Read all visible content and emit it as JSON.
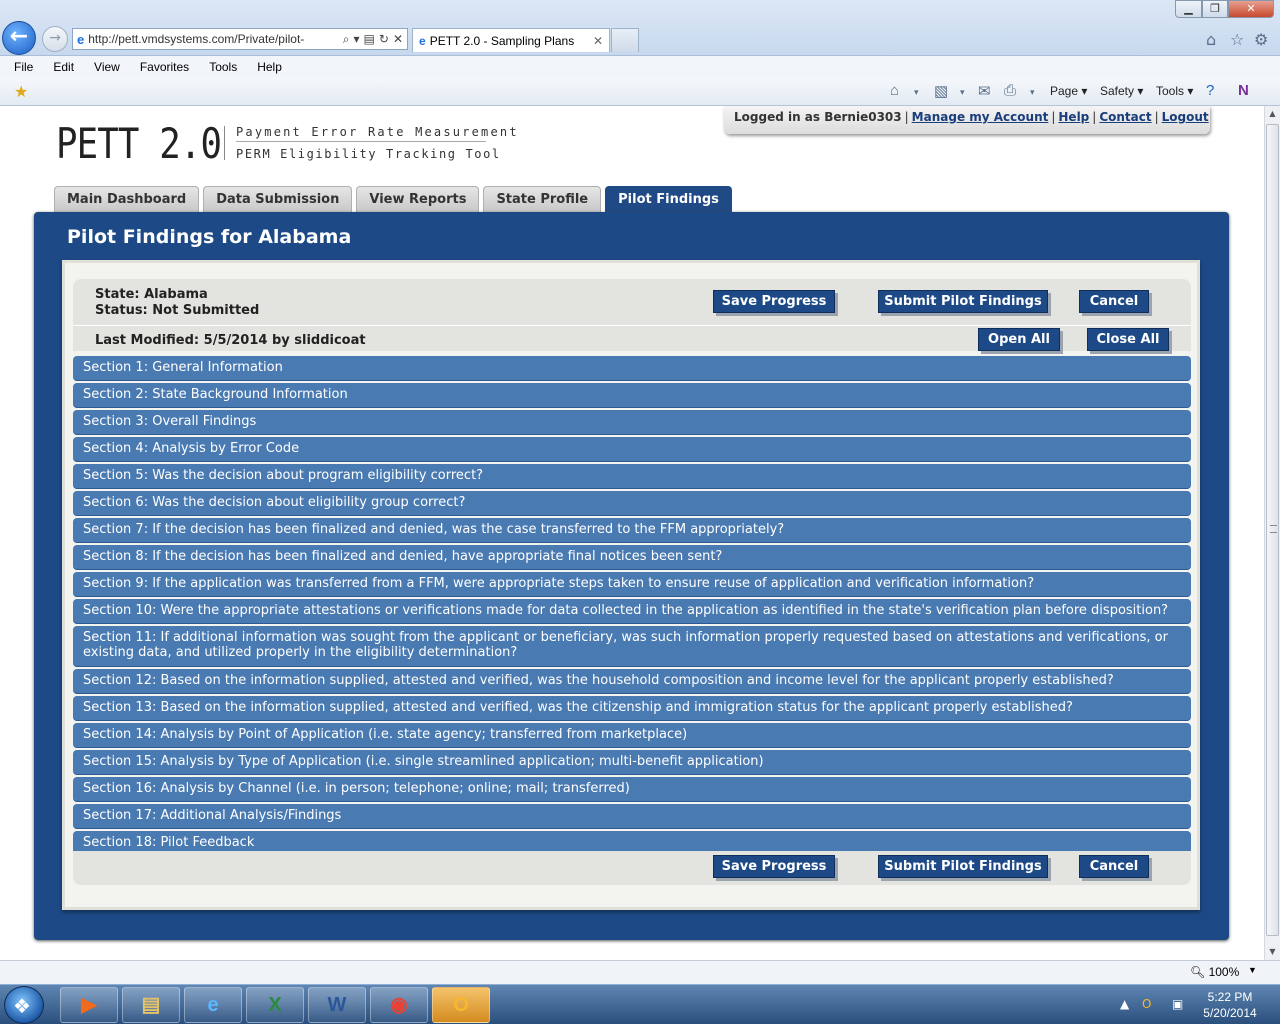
{
  "browser": {
    "url": "http://pett.vmdsystems.com/Private/pilot-",
    "tab_title": "PETT 2.0 - Sampling Plans",
    "menu": [
      "File",
      "Edit",
      "View",
      "Favorites",
      "Tools",
      "Help"
    ],
    "command_bar": {
      "page": "Page ▾",
      "safety": "Safety ▾",
      "tools": "Tools ▾"
    },
    "zoom": "100%"
  },
  "logo": {
    "main": "PETT 2.0",
    "line1": "Payment Error Rate Measurement",
    "line2": "PERM Eligibility Tracking Tool"
  },
  "account": {
    "logged_in": "Logged in as Bernie0303",
    "manage": "Manage my Account",
    "help": "Help",
    "contact": "Contact",
    "logout": "Logout"
  },
  "tabs": [
    {
      "label": "Main Dashboard"
    },
    {
      "label": "Data Submission"
    },
    {
      "label": "View Reports"
    },
    {
      "label": "State Profile"
    },
    {
      "label": "Pilot Findings"
    }
  ],
  "panel": {
    "title": "Pilot Findings for Alabama",
    "state": "State: Alabama",
    "status": "Status: Not Submitted",
    "last_modified": "Last Modified: 5/5/2014 by sliddicoat",
    "save_label": "Save Progress",
    "submit_label": "Submit Pilot Findings",
    "cancel_label": "Cancel",
    "open_all_label": "Open All",
    "close_all_label": "Close All"
  },
  "sections": [
    "Section 1: General Information",
    "Section 2: State Background Information",
    "Section 3: Overall Findings",
    "Section 4: Analysis by Error Code",
    "Section 5: Was the decision about program eligibility correct?",
    "Section 6: Was the decision about eligibility group correct?",
    "Section 7: If the decision has been finalized and denied, was the case transferred to the FFM appropriately?",
    "Section 8: If the decision has been finalized and denied, have appropriate final notices been sent?",
    "Section 9: If the application was transferred from a FFM, were appropriate steps taken to ensure reuse of application and verification information?",
    "Section 10: Were the appropriate attestations or verifications made for data collected in the application as identified in the state's verification plan before disposition?",
    "Section 11: If additional information was sought from the applicant or beneficiary, was such information properly requested based on attestations and verifications, or existing data, and utilized properly in the eligibility determination?",
    "Section 12: Based on the information supplied, attested and verified, was the household composition and income level for the applicant properly established?",
    "Section 13: Based on the information supplied, attested and verified, was the citizenship and immigration status for the applicant properly established?",
    "Section 14: Analysis by Point of Application (i.e. state agency; transferred from marketplace)",
    "Section 15: Analysis by Type of Application (i.e. single streamlined application; multi-benefit application)",
    "Section 16: Analysis by Channel (i.e. in person; telephone; online; mail; transferred)",
    "Section 17: Additional Analysis/Findings",
    "Section 18: Pilot Feedback"
  ],
  "taskbar": {
    "time": "5:22 PM",
    "date": "5/20/2014"
  }
}
